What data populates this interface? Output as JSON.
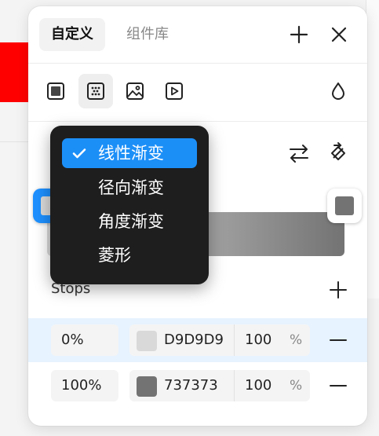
{
  "header": {
    "tab_active": "自定义",
    "tab_inactive": "组件库"
  },
  "fill_types": [
    "solid-fill-icon",
    "gradient-fill-icon",
    "image-fill-icon",
    "video-fill-icon"
  ],
  "gradient_menu": {
    "items": [
      {
        "label": "线性渐变",
        "selected": true
      },
      {
        "label": "径向渐变",
        "selected": false
      },
      {
        "label": "角度渐变",
        "selected": false
      },
      {
        "label": "菱形",
        "selected": false
      }
    ]
  },
  "stops": {
    "title": "Stops",
    "rows": [
      {
        "position": "0%",
        "hex": "D9D9D9",
        "opacity": "100",
        "unit": "%",
        "swatch": "#D9D9D9",
        "selected": true
      },
      {
        "position": "100%",
        "hex": "737373",
        "opacity": "100",
        "unit": "%",
        "swatch": "#737373",
        "selected": false
      }
    ]
  },
  "colors": {
    "accent": "#1C8FF7",
    "menu_bg": "#1E1E1E",
    "selected_row": "#E7F3FF"
  }
}
